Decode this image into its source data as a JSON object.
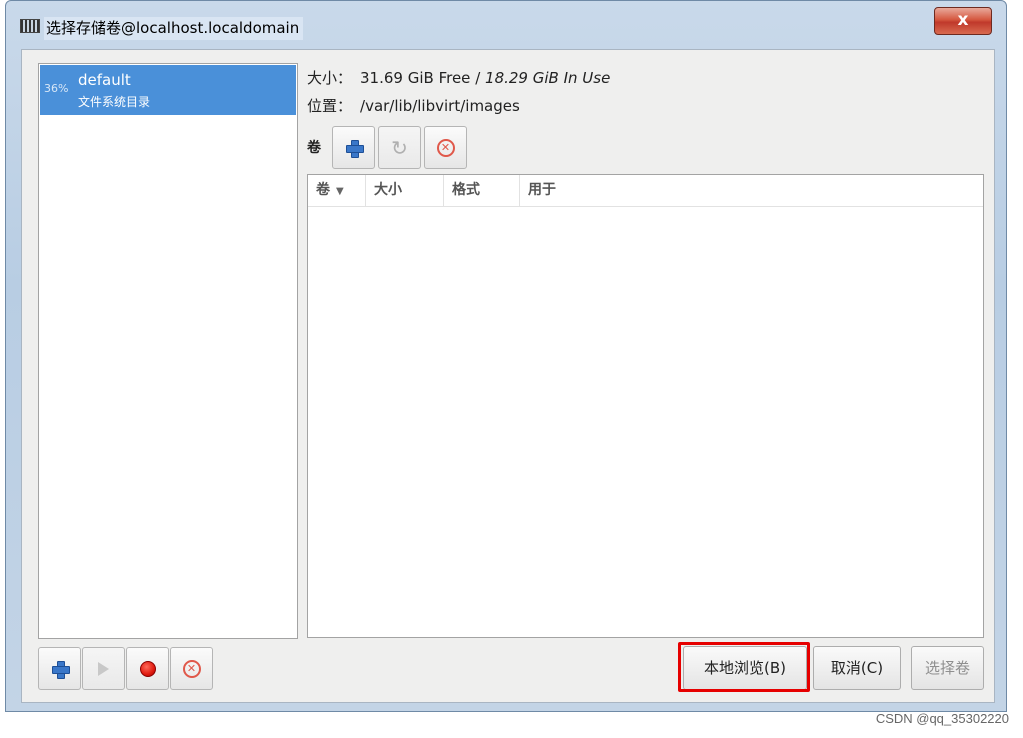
{
  "window": {
    "title": "选择存储卷@localhost.localdomain",
    "close_label": "x"
  },
  "pool_list": {
    "items": [
      {
        "usage": "36%",
        "name": "default",
        "type": "文件系统目录",
        "selected": true
      }
    ]
  },
  "pool_info": {
    "size_label": "大小：",
    "free": "31.69 GiB Free",
    "separator": "/",
    "in_use": "18.29 GiB In Use",
    "location_label": "位置：",
    "location": "/var/lib/libvirt/images"
  },
  "volumes": {
    "label": "卷",
    "toolbar": {
      "add_icon": "plus-icon",
      "refresh_icon": "refresh-icon",
      "delete_icon": "delete-icon"
    },
    "columns": [
      "卷",
      "大小",
      "格式",
      "用于"
    ],
    "sort_glyph": "▼",
    "rows": []
  },
  "pool_toolbar": {
    "add_icon": "plus-icon",
    "start_icon": "play-icon",
    "stop_icon": "record-icon",
    "delete_icon": "delete-icon"
  },
  "buttons": {
    "browse_local": "本地浏览(B)",
    "cancel": "取消(C)",
    "choose_volume": "选择卷"
  },
  "glyphs": {
    "refresh": "↻",
    "delete": "✕"
  },
  "colors": {
    "selection": "#4a90d9",
    "highlight": "#e60000",
    "delete": "#e0584a"
  },
  "watermark": "CSDN @qq_35302220"
}
